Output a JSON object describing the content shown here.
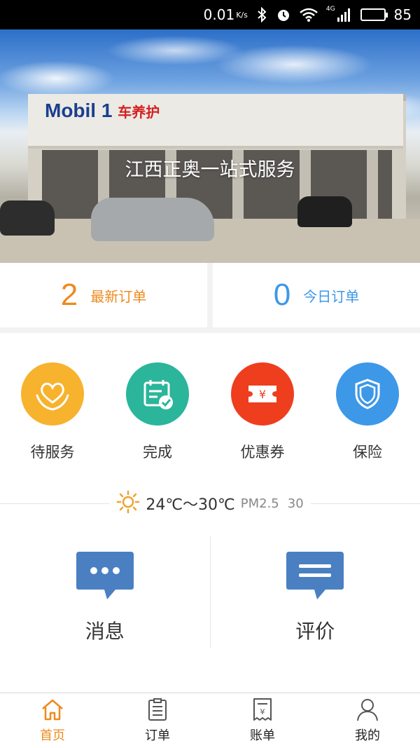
{
  "status_bar": {
    "net_speed": "0.01",
    "net_speed_unit": "K/s",
    "network": "4G",
    "battery": "85",
    "battery_level": 0.85,
    "icons": [
      "bluetooth-icon",
      "alarm-icon",
      "wifi-icon",
      "signal-icon",
      "battery-icon"
    ]
  },
  "banner": {
    "title": "江西正奥一站式服务",
    "logo_text": "Mobil 1",
    "logo_sub": "车养护"
  },
  "orders": {
    "new": {
      "count": "2",
      "label": "最新订单"
    },
    "today": {
      "count": "0",
      "label": "今日订单"
    }
  },
  "features": [
    {
      "label": "待服务",
      "icon": "heart-hands-icon",
      "color": "#f7b22e"
    },
    {
      "label": "完成",
      "icon": "calendar-check-icon",
      "color": "#2bb59a"
    },
    {
      "label": "优惠券",
      "icon": "coupon-icon",
      "color": "#ee3e1e"
    },
    {
      "label": "保险",
      "icon": "shield-icon",
      "color": "#3d98e8"
    }
  ],
  "weather": {
    "temperature": "24℃～30℃",
    "pm_label": "PM2.5",
    "pm_value": "30",
    "icon": "sun-icon"
  },
  "actions": {
    "messages": {
      "label": "消息",
      "icon": "chat-dots-icon"
    },
    "reviews": {
      "label": "评价",
      "icon": "chat-lines-icon"
    }
  },
  "tabs": [
    {
      "label": "首页",
      "icon": "home-icon",
      "active": true
    },
    {
      "label": "订单",
      "icon": "order-list-icon",
      "active": false
    },
    {
      "label": "账单",
      "icon": "bill-icon",
      "active": false
    },
    {
      "label": "我的",
      "icon": "user-icon",
      "active": false
    }
  ],
  "colors": {
    "accent": "#ee8a1e",
    "blue": "#3d98e8",
    "icon_blue": "#4a80c2"
  }
}
